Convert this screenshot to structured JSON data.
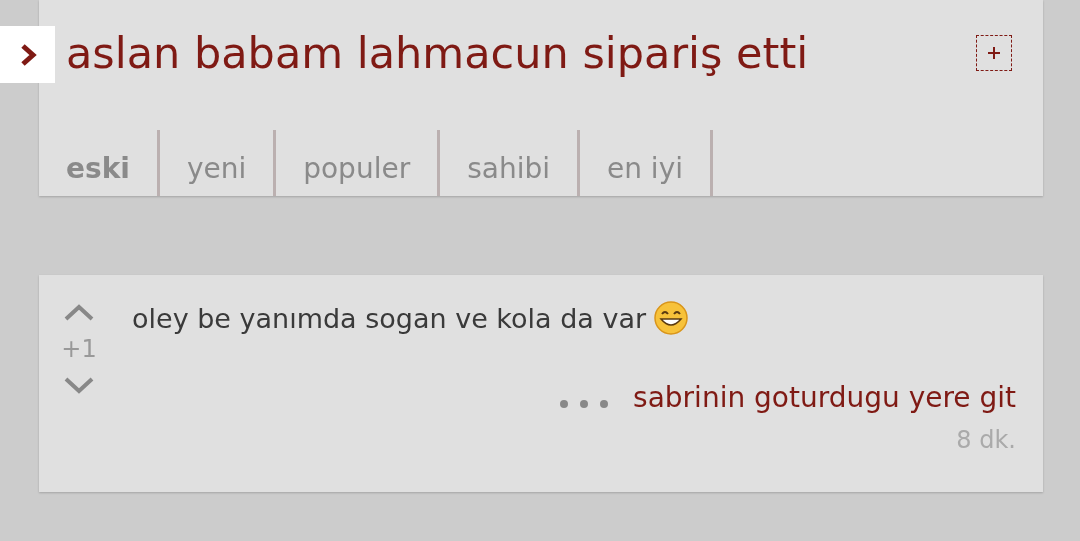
{
  "header": {
    "title": "aslan babam lahmacun sipariş etti"
  },
  "tabs": [
    {
      "label": "eski",
      "selected": true
    },
    {
      "label": "yeni",
      "selected": false
    },
    {
      "label": "populer",
      "selected": false
    },
    {
      "label": "sahibi",
      "selected": false
    },
    {
      "label": "en iyi",
      "selected": false
    }
  ],
  "comments": [
    {
      "text": "oley be yanımda sogan ve kola da var",
      "votes": "+1",
      "author": "sabrinin goturdugu yere git",
      "time": "8 dk."
    }
  ]
}
